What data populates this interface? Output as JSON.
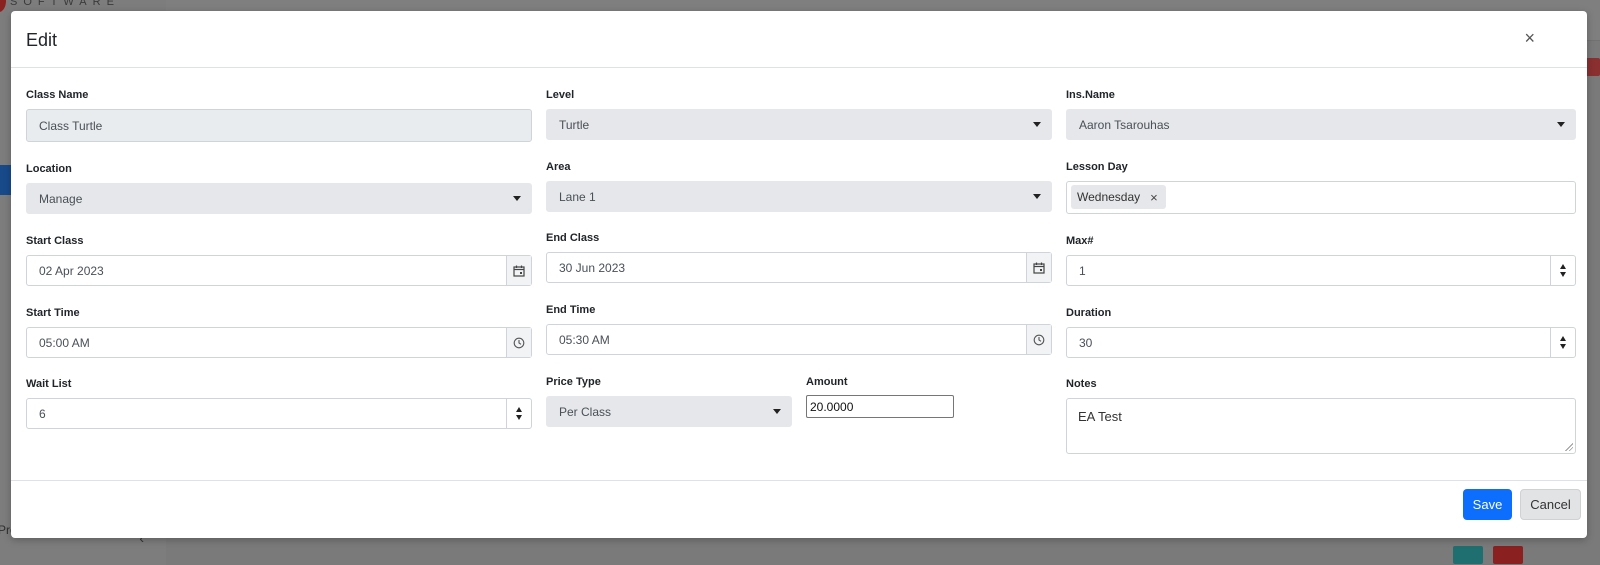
{
  "background": {
    "logo_text": "SOFTWARE",
    "sidebar_bottom_label": "Profile"
  },
  "modal": {
    "title": "Edit",
    "close_symbol": "×",
    "fields": {
      "class_name": {
        "label": "Class Name",
        "value": "Class Turtle"
      },
      "level": {
        "label": "Level",
        "value": "Turtle"
      },
      "ins_name": {
        "label": "Ins.Name",
        "value": "Aaron Tsarouhas"
      },
      "location": {
        "label": "Location",
        "value": "Manage"
      },
      "area": {
        "label": "Area",
        "value": "Lane 1"
      },
      "lesson_day": {
        "label": "Lesson Day",
        "tags": [
          "Wednesday"
        ],
        "remove_symbol": "×"
      },
      "start_class": {
        "label": "Start Class",
        "value": "02 Apr 2023"
      },
      "end_class": {
        "label": "End Class",
        "value": "30 Jun 2023"
      },
      "max": {
        "label": "Max#",
        "value": "1"
      },
      "start_time": {
        "label": "Start Time",
        "value": "05:00 AM"
      },
      "end_time": {
        "label": "End Time",
        "value": "05:30 AM"
      },
      "duration": {
        "label": "Duration",
        "value": "30"
      },
      "wait_list": {
        "label": "Wait List",
        "value": "6"
      },
      "price_type": {
        "label": "Price Type",
        "value": "Per Class"
      },
      "amount": {
        "label": "Amount",
        "value": "20.0000"
      },
      "notes": {
        "label": "Notes",
        "value": "EA Test"
      }
    },
    "buttons": {
      "save": "Save",
      "cancel": "Cancel"
    }
  },
  "colors": {
    "primary": "#0d6efd",
    "sidebar_active": "#184a8a"
  }
}
